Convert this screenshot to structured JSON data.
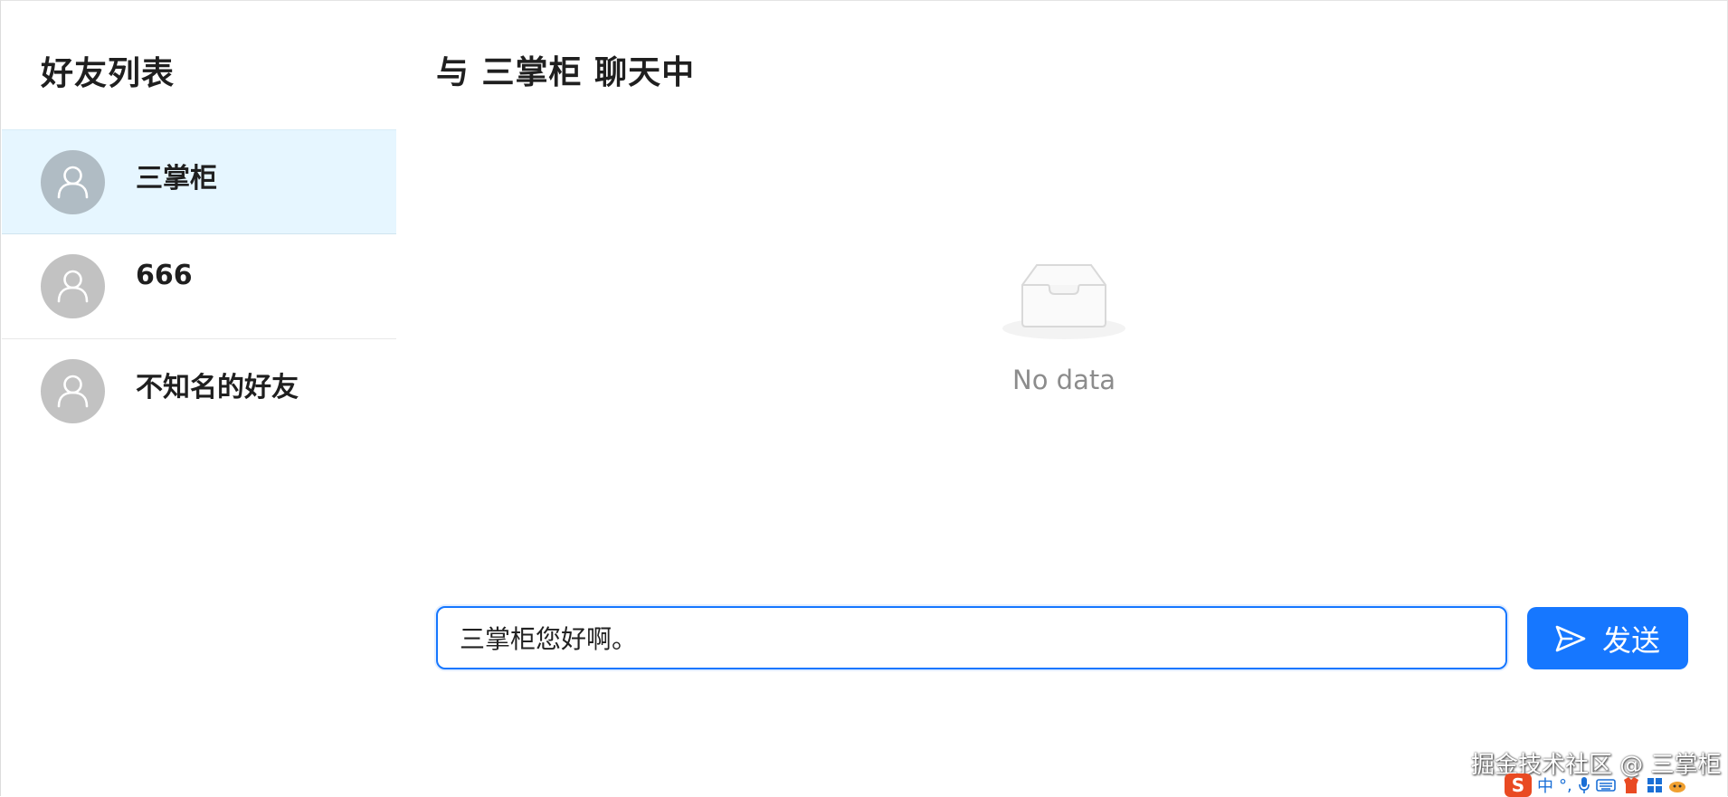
{
  "sidebar": {
    "title": "好友列表",
    "friends": [
      {
        "name": "三掌柜",
        "active": true
      },
      {
        "name": "666",
        "active": false
      },
      {
        "name": "不知名的好友",
        "active": false
      }
    ]
  },
  "chat": {
    "title": "与 三掌柜 聊天中",
    "empty_text": "No data",
    "input_value": "三掌柜您好啊。",
    "send_label": "发送"
  },
  "watermark": "掘金技术社区 @ 三掌柜",
  "ime": {
    "logo": "S",
    "mode": "中",
    "punct": "°,"
  },
  "colors": {
    "primary": "#1677ff",
    "active_row": "#e6f6ff",
    "avatar": "#c2c2c2"
  }
}
